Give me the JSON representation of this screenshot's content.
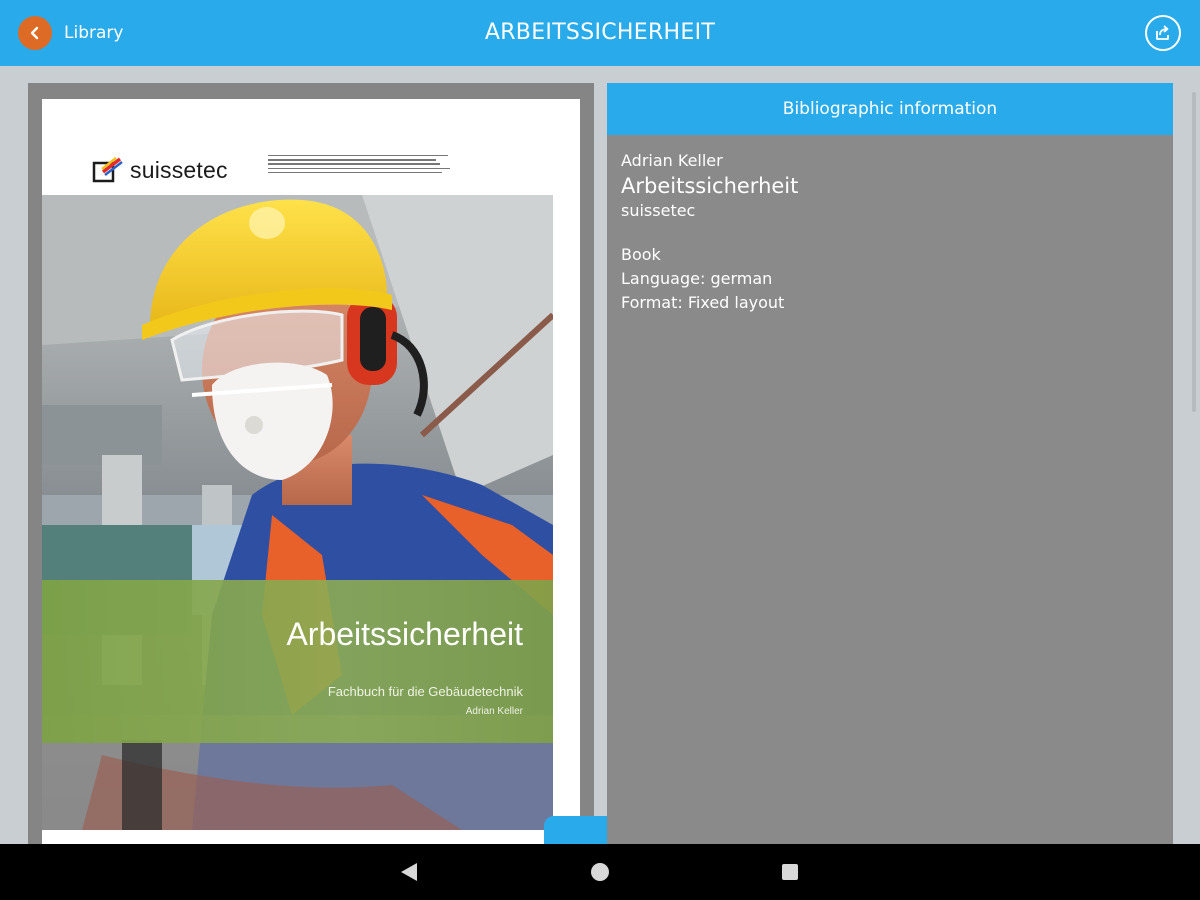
{
  "topbar": {
    "back_label": "Library",
    "title": "ARBEITSSICHERHEIT",
    "back_icon": "chevron-left-icon",
    "share_icon": "share-icon"
  },
  "cover": {
    "logo_text": "suissetec",
    "title": "Arbeitssicherheit",
    "subtitle": "Fachbuch für die Gebäudetechnik",
    "author": "Adrian Keller"
  },
  "info": {
    "header": "Bibliographic information",
    "author": "Adrian Keller",
    "title": "Arbeitssicherheit",
    "publisher": "suissetec",
    "type": "Book",
    "language": "Language: german",
    "format": "Format: Fixed layout"
  },
  "colors": {
    "accent": "#29abeb",
    "back_button": "#dd6b25",
    "panel": "#8a8a8a",
    "cover_band": "#8aa84f"
  },
  "navbar": {
    "back_icon": "nav-back-icon",
    "home_icon": "nav-home-icon",
    "recent_icon": "nav-recent-icon"
  }
}
